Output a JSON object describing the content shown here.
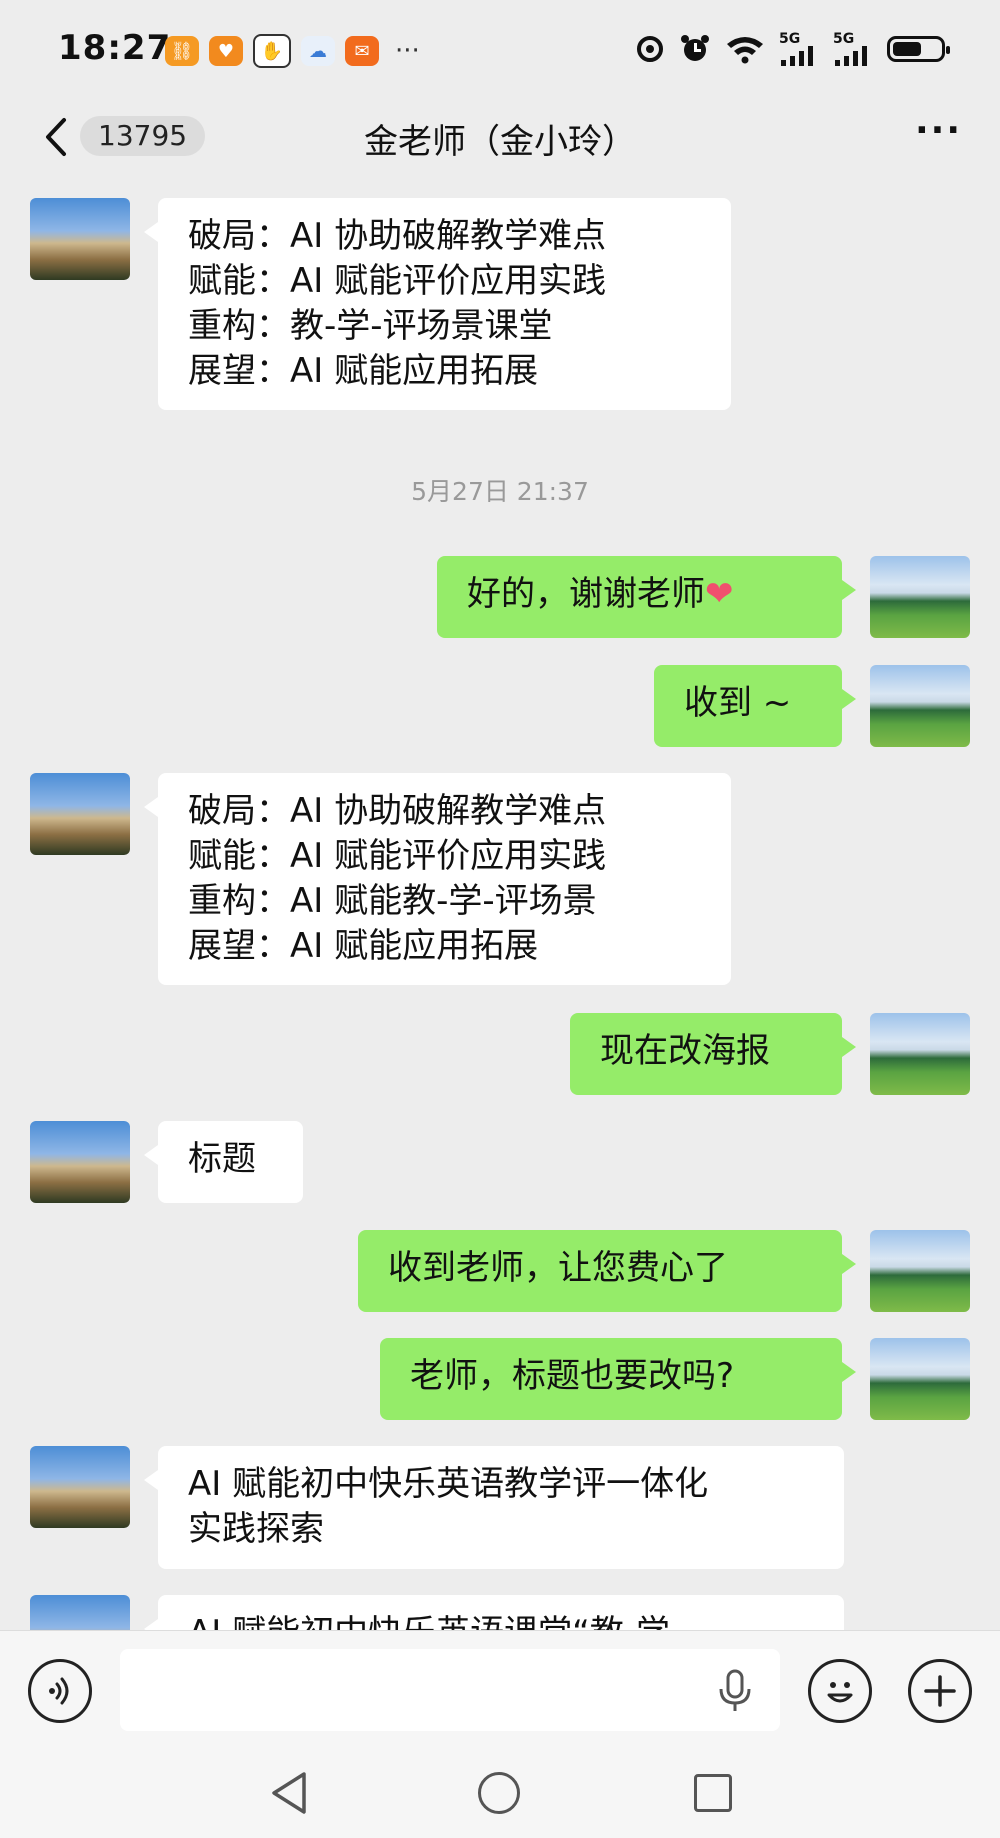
{
  "status_bar": {
    "time": "18:27",
    "more": "···",
    "network_1": "5G",
    "network_2": "5G"
  },
  "header": {
    "back_count": "13795",
    "title": "金老师（金小玲）",
    "menu": "···"
  },
  "messages": [
    {
      "side": "left",
      "text": "破局：AI 协助破解教学难点\n赋能：AI 赋能评价应用实践\n重构：教-学-评场景课堂\n展望：AI 赋能应用拓展"
    },
    {
      "type": "timestamp",
      "text": "5月27日 21:37"
    },
    {
      "side": "right",
      "text": "好的，谢谢老师",
      "emoji": "❤"
    },
    {
      "side": "right",
      "text": "收到 ~"
    },
    {
      "side": "left",
      "text": "破局：AI 协助破解教学难点\n赋能：AI 赋能评价应用实践\n重构：AI 赋能教-学-评场景\n展望：AI 赋能应用拓展"
    },
    {
      "side": "right",
      "text": "现在改海报"
    },
    {
      "side": "left",
      "text": "标题"
    },
    {
      "side": "right",
      "text": "收到老师，让您费心了"
    },
    {
      "side": "right",
      "text": "老师，标题也要改吗?"
    },
    {
      "side": "left",
      "text": "AI 赋能初中快乐英语教学评一体化\n实践探索"
    },
    {
      "side": "left",
      "text": "AI 赋能初中快乐英语课堂“教-学"
    }
  ],
  "input_bar": {
    "voice_icon": "voice-icon",
    "mic_icon": "microphone-icon",
    "emoji_icon": "emoji-icon",
    "plus_icon": "plus-icon"
  },
  "colors": {
    "chat_bg": "#ededed",
    "self_bubble": "#95ec69",
    "other_bubble": "#ffffff"
  }
}
